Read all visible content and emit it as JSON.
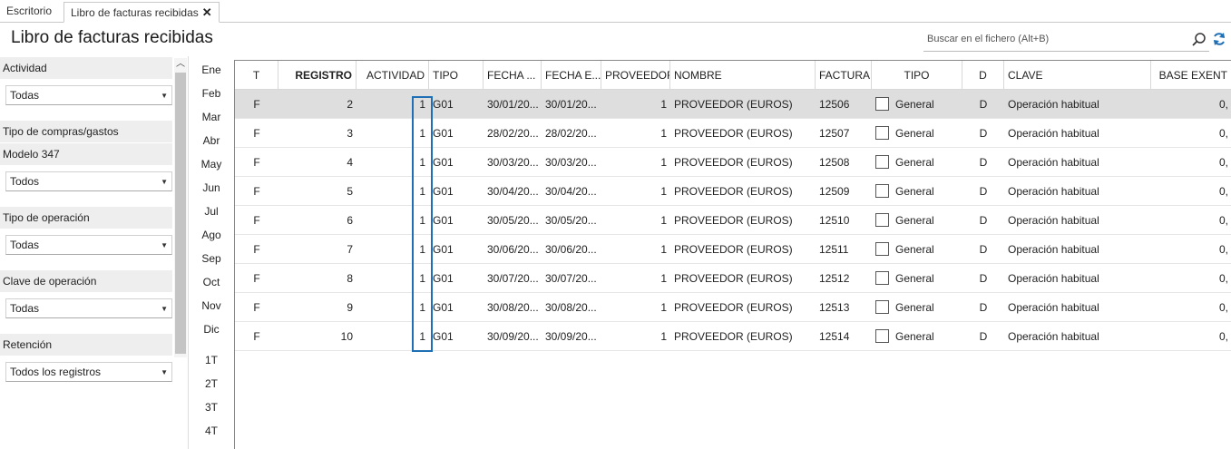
{
  "tabs": [
    {
      "label": "Escritorio"
    },
    {
      "label": "Libro de facturas recibidas"
    }
  ],
  "page": {
    "title": "Libro de facturas recibidas"
  },
  "search": {
    "placeholder": "Buscar en el fichero (Alt+B)"
  },
  "filters": [
    {
      "label": "Actividad",
      "value": "Todas"
    },
    {
      "label": "Tipo de compras/gastos"
    },
    {
      "label": "Modelo 347",
      "value": "Todos"
    },
    {
      "label": "Tipo de operación",
      "value": "Todas"
    },
    {
      "label": "Clave de operación",
      "value": "Todas"
    },
    {
      "label": "Retención",
      "value": "Todos los registros"
    }
  ],
  "periods": [
    "Ene",
    "Feb",
    "Mar",
    "Abr",
    "May",
    "Jun",
    "Jul",
    "Ago",
    "Sep",
    "Oct",
    "Nov",
    "Dic",
    "1T",
    "2T",
    "3T",
    "4T"
  ],
  "table": {
    "columns": [
      "T",
      "REGISTRO",
      "ACTIVIDAD",
      "TIPO",
      "FECHA ...",
      "FECHA E...",
      "PROVEEDOR",
      "NOMBRE",
      "FACTURA",
      "TIPO",
      "D",
      "CLAVE",
      "BASE EXENT"
    ],
    "rows": [
      [
        "F",
        "2",
        "1",
        "G01",
        "30/01/20...",
        "30/01/20...",
        "1",
        "PROVEEDOR (EUROS)",
        "12506",
        "General",
        "D",
        "Operación habitual",
        "0,"
      ],
      [
        "F",
        "3",
        "1",
        "G01",
        "28/02/20...",
        "28/02/20...",
        "1",
        "PROVEEDOR (EUROS)",
        "12507",
        "General",
        "D",
        "Operación habitual",
        "0,"
      ],
      [
        "F",
        "4",
        "1",
        "G01",
        "30/03/20...",
        "30/03/20...",
        "1",
        "PROVEEDOR (EUROS)",
        "12508",
        "General",
        "D",
        "Operación habitual",
        "0,"
      ],
      [
        "F",
        "5",
        "1",
        "G01",
        "30/04/20...",
        "30/04/20...",
        "1",
        "PROVEEDOR (EUROS)",
        "12509",
        "General",
        "D",
        "Operación habitual",
        "0,"
      ],
      [
        "F",
        "6",
        "1",
        "G01",
        "30/05/20...",
        "30/05/20...",
        "1",
        "PROVEEDOR (EUROS)",
        "12510",
        "General",
        "D",
        "Operación habitual",
        "0,"
      ],
      [
        "F",
        "7",
        "1",
        "G01",
        "30/06/20...",
        "30/06/20...",
        "1",
        "PROVEEDOR (EUROS)",
        "12511",
        "General",
        "D",
        "Operación habitual",
        "0,"
      ],
      [
        "F",
        "8",
        "1",
        "G01",
        "30/07/20...",
        "30/07/20...",
        "1",
        "PROVEEDOR (EUROS)",
        "12512",
        "General",
        "D",
        "Operación habitual",
        "0,"
      ],
      [
        "F",
        "9",
        "1",
        "G01",
        "30/08/20...",
        "30/08/20...",
        "1",
        "PROVEEDOR (EUROS)",
        "12513",
        "General",
        "D",
        "Operación habitual",
        "0,"
      ],
      [
        "F",
        "10",
        "1",
        "G01",
        "30/09/20...",
        "30/09/20...",
        "1",
        "PROVEEDOR (EUROS)",
        "12514",
        "General",
        "D",
        "Operación habitual",
        "0,"
      ]
    ]
  },
  "colors": {
    "accent": "#1f6fb5",
    "selected_row": "#dedede",
    "filter_header": "#eeeeee"
  }
}
